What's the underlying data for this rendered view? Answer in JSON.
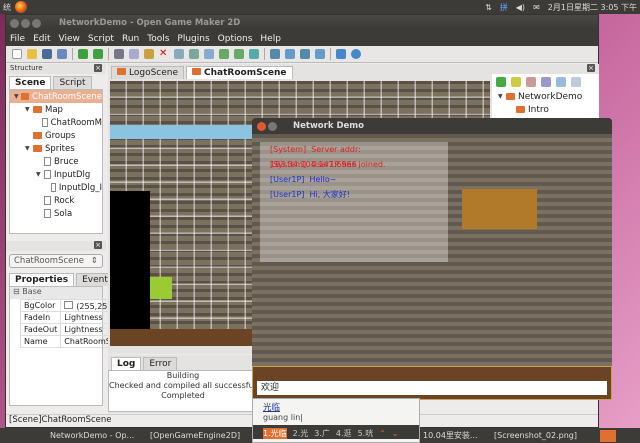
{
  "top_panel": {
    "left_text": "统",
    "clock": "2月1日星期二 3:05 下午",
    "input_method": "拼"
  },
  "window": {
    "title": "NetworkDemo - Open Game Maker 2D"
  },
  "menu": [
    "File",
    "Edit",
    "View",
    "Script",
    "Run",
    "Tools",
    "Plugins",
    "Options",
    "Help"
  ],
  "structure": {
    "title": "Structure",
    "tabs": [
      "Scene",
      "Script"
    ],
    "tree": [
      {
        "label": "ChatRoomScene",
        "depth": 0,
        "icon": "folder-icon",
        "selected": true
      },
      {
        "label": "Map",
        "depth": 1,
        "icon": "folder-icon"
      },
      {
        "label": "ChatRoomM",
        "depth": 2,
        "icon": "file-icon"
      },
      {
        "label": "Groups",
        "depth": 1,
        "icon": "folder-icon"
      },
      {
        "label": "Sprites",
        "depth": 1,
        "icon": "folder-icon"
      },
      {
        "label": "Bruce",
        "depth": 2,
        "icon": "file-icon"
      },
      {
        "label": "InputDlg",
        "depth": 2,
        "icon": "file-icon"
      },
      {
        "label": "InputDlg_I",
        "depth": 3,
        "icon": "file-icon"
      },
      {
        "label": "Rock",
        "depth": 2,
        "icon": "file-icon"
      },
      {
        "label": "Sola",
        "depth": 2,
        "icon": "file-icon"
      }
    ]
  },
  "props": {
    "scene_select": "ChatRoomScene",
    "tabs": [
      "Properties",
      "Events"
    ],
    "group": "Base",
    "rows": [
      {
        "name": "BgColor",
        "value": "(255,25"
      },
      {
        "name": "FadeIn",
        "value": "Lightness"
      },
      {
        "name": "FadeOut",
        "value": "Lightness"
      },
      {
        "name": "Name",
        "value": "ChatRoomS"
      }
    ]
  },
  "editor": {
    "tabs": [
      "LogoScene",
      "ChatRoomScene"
    ]
  },
  "log": {
    "tabs": [
      "Log",
      "Error"
    ],
    "lines": [
      "Building",
      "Checked and compiled all successfully",
      "Completed"
    ]
  },
  "project": {
    "tree": [
      "NetworkDemo",
      "Intro"
    ]
  },
  "status": "[Scene]ChatRoomScene",
  "demo": {
    "title": "Network Demo",
    "messages": [
      {
        "from": "[System]",
        "text": "Server addr: 183.34.104.147:6966",
        "color": "#e02020"
      },
      {
        "from": "[System]",
        "text": "User1P has joined.",
        "color": "#e02020"
      },
      {
        "from": "[User1P]",
        "text": "Hello~",
        "color": "#2030d0"
      },
      {
        "from": "[User1P]",
        "text": "Hi, 大家好!",
        "color": "#2030d0"
      }
    ],
    "input_value": "欢迎"
  },
  "ime": {
    "preedit": "光临",
    "pinyin": "guang lin|",
    "candidates": [
      "1.光临",
      "2.光",
      "3.广",
      "4.逛",
      "5.咣"
    ]
  },
  "taskbar": [
    "NetworkDemo - Op...",
    "[OpenGameEngine2D]",
    "10.04里安装...",
    "[Screenshot_02.png]"
  ]
}
